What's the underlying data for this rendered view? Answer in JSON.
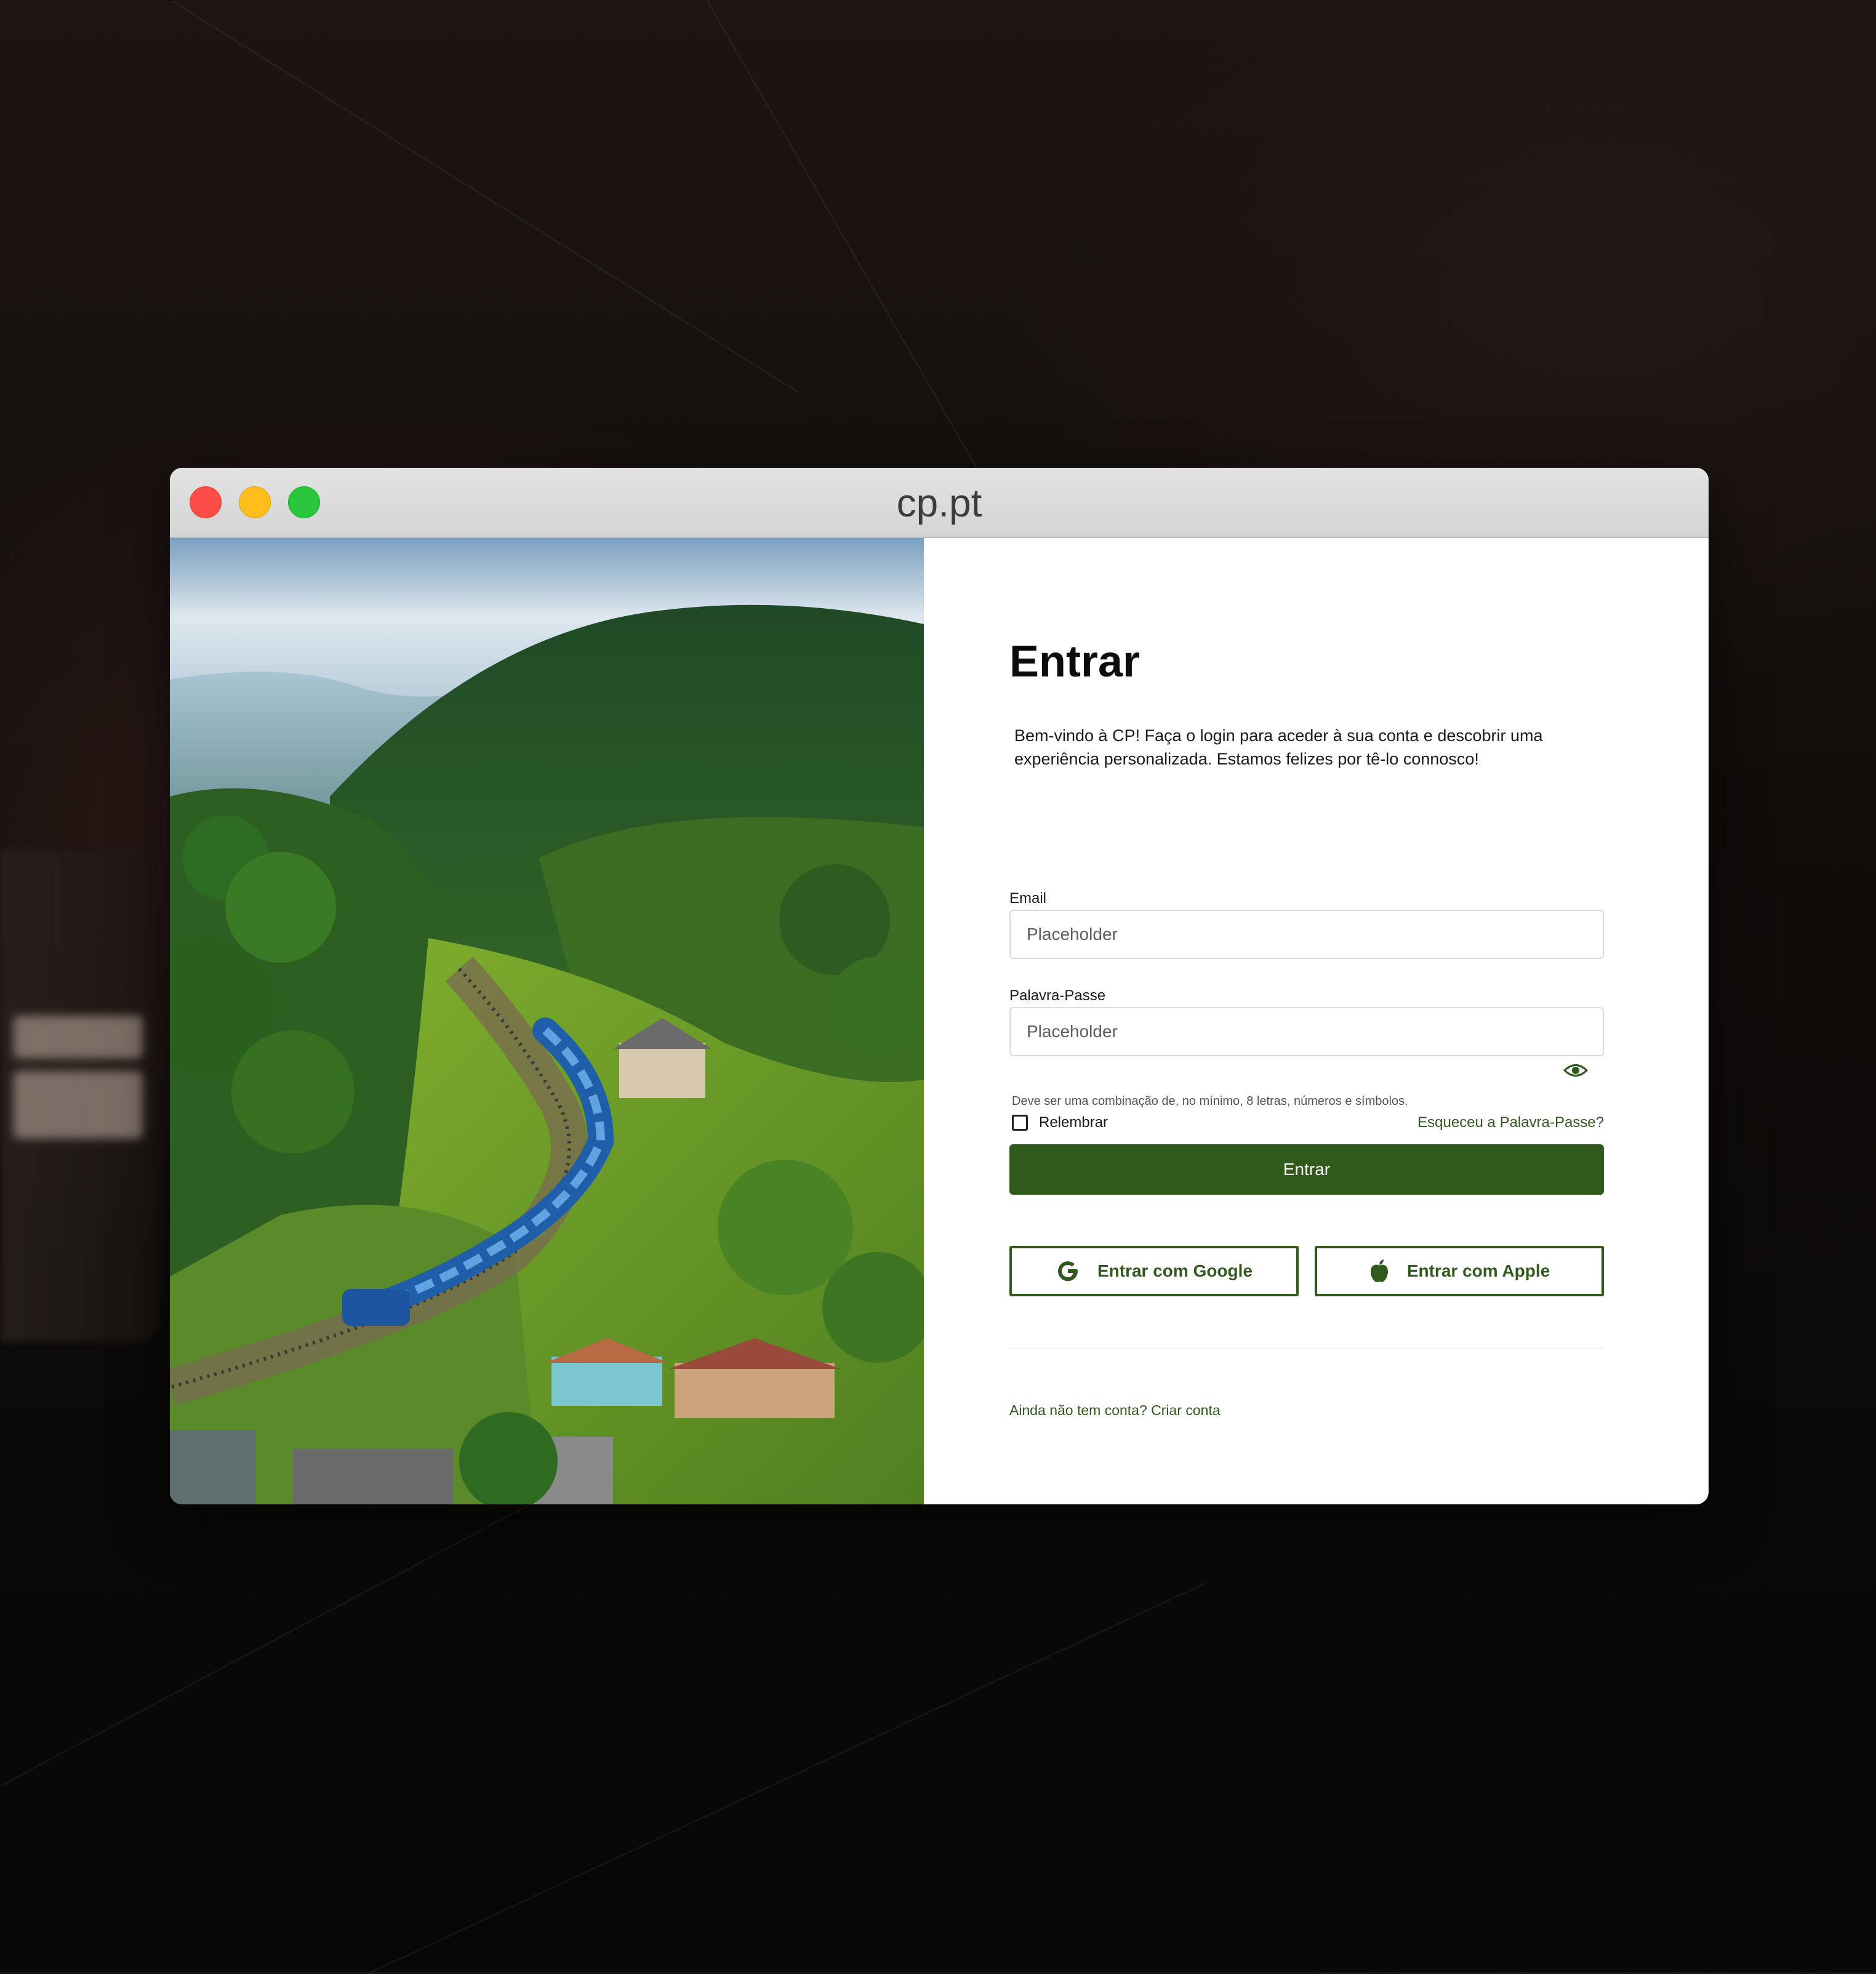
{
  "browser": {
    "url": "cp.pt"
  },
  "login": {
    "title": "Entrar",
    "intro": "Bem-vindo à CP! Faça o login para aceder à sua conta e descobrir uma experiência personalizada. Estamos felizes por tê-lo connosco!",
    "email_label": "Email",
    "email_placeholder": "Placeholder",
    "password_label": "Palavra-Passe",
    "password_placeholder": "Placeholder",
    "password_hint": "Deve ser uma combinação de, no mínimo, 8 letras, números e símbolos.",
    "remember_label": "Relembrar",
    "remember_checked": false,
    "forgot_link": "Esqueceu a Palavra-Passe?",
    "submit_label": "Entrar",
    "google_label": "Entrar com Google",
    "apple_label": "Entrar com Apple",
    "signup_link": "Ainda não tem conta? Criar conta"
  },
  "icons": {
    "password_toggle": "eye-icon",
    "google": "google-icon",
    "apple": "apple-icon"
  },
  "colors": {
    "accent": "#2f5a1c",
    "close": "#fe4c47",
    "minimize": "#ffbe1c",
    "maximize": "#29c63c"
  }
}
